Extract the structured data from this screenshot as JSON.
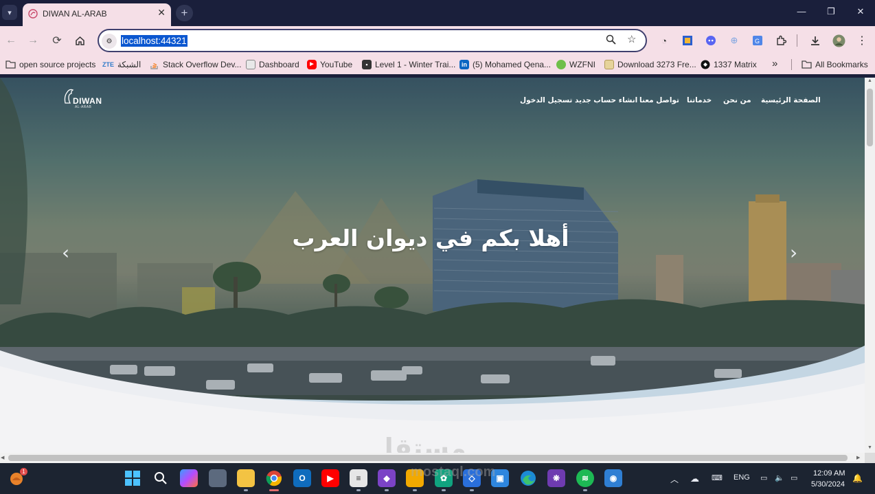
{
  "browser": {
    "tab_title": "DIWAN AL-ARAB",
    "tab_close": "✕",
    "new_tab": "+",
    "window_controls": {
      "minimize": "—",
      "restore": "❐",
      "close": "✕"
    },
    "url": "localhost:44321"
  },
  "bookmarks": [
    {
      "label": "open source projects",
      "icon": "folder-icon"
    },
    {
      "label": "الشبكة",
      "icon": "zte-icon",
      "icon_text": "ZTE"
    },
    {
      "label": "Stack Overflow Dev...",
      "icon": "stackoverflow-icon"
    },
    {
      "label": "Dashboard",
      "icon": "dashboard-icon"
    },
    {
      "label": "YouTube",
      "icon": "youtube-icon"
    },
    {
      "label": "Level 1 - Winter Trai...",
      "icon": "contact-card-icon"
    },
    {
      "label": "(5) Mohamed Qena...",
      "icon": "linkedin-icon",
      "icon_text": "in"
    },
    {
      "label": "WZFNI",
      "icon": "wzfni-icon"
    },
    {
      "label": "Download 3273 Fre...",
      "icon": "download-site-icon"
    },
    {
      "label": "1337 Matrix",
      "icon": "matrix-icon"
    }
  ],
  "bookmarks_more": "»",
  "all_bookmarks": "All Bookmarks",
  "site": {
    "logo_text": "DIWAN",
    "logo_sub": "AL-ARAB",
    "nav": {
      "home": "الصفحة الرئيسية",
      "about": "من نحن",
      "services": "خدماتنا",
      "contact": "تواصل معنا",
      "register": "انشاء حساب جديد",
      "login": "تسجيل الدخول"
    },
    "hero_heading": "أهلا بكم في ديوان العرب",
    "prev_arrow": "‹",
    "next_arrow": "›"
  },
  "watermark": {
    "arabic": "مستقل",
    "latin": "mostaql.com"
  },
  "taskbar": {
    "notification_badge": "1",
    "language": "ENG",
    "time": "12:09 AM",
    "date": "5/30/2024"
  }
}
